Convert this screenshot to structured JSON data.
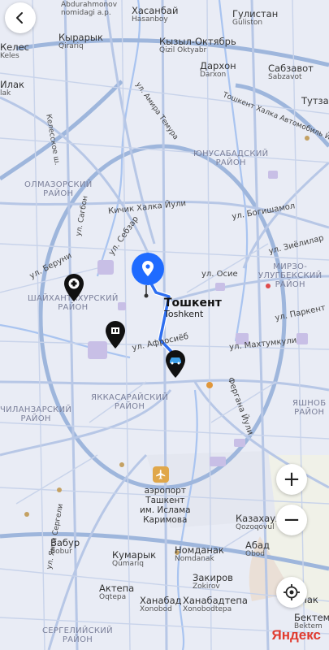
{
  "brand": "Яндекс",
  "city": {
    "name": "Тошкент",
    "sub": "Toshkent"
  },
  "airport": {
    "lines": [
      "аэропорт",
      "Ташкент",
      "им. Ислама",
      "Каримова"
    ]
  },
  "places": [
    {
      "id": "abdurahmonov",
      "main": "Abdurahmonov",
      "sub": "nomidagi a.p."
    },
    {
      "id": "hasanboy",
      "main": "Хасанбай",
      "sub": "Hasanboy"
    },
    {
      "id": "guliston",
      "main": "Гулистан",
      "sub": "Guliston"
    },
    {
      "id": "qirqiz",
      "main": "Кырарык",
      "sub": "Qirariq"
    },
    {
      "id": "keles",
      "main": "Келес",
      "sub": "Keles"
    },
    {
      "id": "qizil",
      "main": "Кызыл-Октябрь",
      "sub": "Qizil Oktyabr"
    },
    {
      "id": "darhon",
      "main": "Дархон",
      "sub": "Darxon"
    },
    {
      "id": "sabzavot",
      "main": "Сабзавот",
      "sub": "Sabzavot"
    },
    {
      "id": "tutzar",
      "main": "Тутзар",
      "sub": ""
    },
    {
      "id": "yaylak",
      "main": "Илак",
      "sub": "lak"
    },
    {
      "id": "bobur",
      "main": "Бабур",
      "sub": "Bobur"
    },
    {
      "id": "qumariq",
      "main": "Кумарык",
      "sub": "Qumariq"
    },
    {
      "id": "nomdanak",
      "main": "Номданак",
      "sub": "Nomdanak"
    },
    {
      "id": "obod",
      "main": "Абад",
      "sub": "Obod"
    },
    {
      "id": "kazakhaul",
      "main": "Казахаул",
      "sub": "Qozoqovul"
    },
    {
      "id": "oqtepa",
      "main": "Актепа",
      "sub": "Oqtepa"
    },
    {
      "id": "xonobod",
      "main": "Ханабад",
      "sub": "Xonobod"
    },
    {
      "id": "zakirov",
      "main": "Закиров",
      "sub": "Zokirov"
    },
    {
      "id": "xonobodtepa",
      "main": "Ханабадтепа",
      "sub": "Xonobodtepa"
    },
    {
      "id": "bektemir",
      "main": "Бектем",
      "sub": "Bektem"
    },
    {
      "id": "kelbek",
      "main": "Чак",
      "sub": ""
    }
  ],
  "districts": [
    {
      "id": "yunusobod",
      "lines": [
        "ЮНУСАБАДСКИЙ",
        "РАЙОН"
      ]
    },
    {
      "id": "olmazor",
      "lines": [
        "ОЛМАЗОРСКИЙ",
        "РАЙОН"
      ]
    },
    {
      "id": "mirzo",
      "lines": [
        "МИРЗО-",
        "УЛУГБЕКСКИЙ",
        "РАЙОН"
      ]
    },
    {
      "id": "shayxon",
      "lines": [
        "ШАЙХАНТАХУРСКИЙ",
        "РАЙОН"
      ]
    },
    {
      "id": "yakkasaroy",
      "lines": [
        "ЯККАСАРАЙСКИЙ",
        "РАЙОН"
      ]
    },
    {
      "id": "chilonzor",
      "lines": [
        "ЧИЛАНЗАРСКИЙ",
        "РАЙОН"
      ]
    },
    {
      "id": "yashnobod",
      "lines": [
        "ЯШНОБ",
        "РАЙОН"
      ]
    },
    {
      "id": "sergeli",
      "lines": [
        "СЕРГЕЛИЙСКИЙ",
        "РАЙОН"
      ]
    }
  ],
  "streets": [
    {
      "id": "kichik",
      "text": "Кичик Халка Йули"
    },
    {
      "id": "sebzar",
      "text": "ул. Себзар"
    },
    {
      "id": "osie",
      "text": "ул. Осие"
    },
    {
      "id": "afrosiyob",
      "text": "ул. Афросиёб"
    },
    {
      "id": "maxtumkuli",
      "text": "ул. Махтумкули"
    },
    {
      "id": "parkent",
      "text": "ул. Паркент"
    },
    {
      "id": "ziyolilar",
      "text": "ул. Зиёлилар"
    },
    {
      "id": "bogishamol",
      "text": "ул. Богишамол"
    },
    {
      "id": "fargona",
      "text": "Фергана Йули"
    },
    {
      "id": "tk_halqa",
      "text": "Тошкент Халка Автомобиль Йули"
    },
    {
      "id": "beruni",
      "text": "ул. Беруни"
    },
    {
      "id": "sagbon",
      "text": "ул. Сагбон"
    },
    {
      "id": "keles_sh",
      "text": "Келесское ш."
    },
    {
      "id": "amir",
      "text": "ул. Амира Темура"
    },
    {
      "id": "sergeli_s",
      "text": "ул. Янги Сергели"
    }
  ],
  "controls": {
    "zoom_in": "+",
    "zoom_out": "−"
  },
  "colors": {
    "route": "#2f6ff0",
    "pin": "#1f6bff",
    "accent_red": "#e03a2f"
  }
}
